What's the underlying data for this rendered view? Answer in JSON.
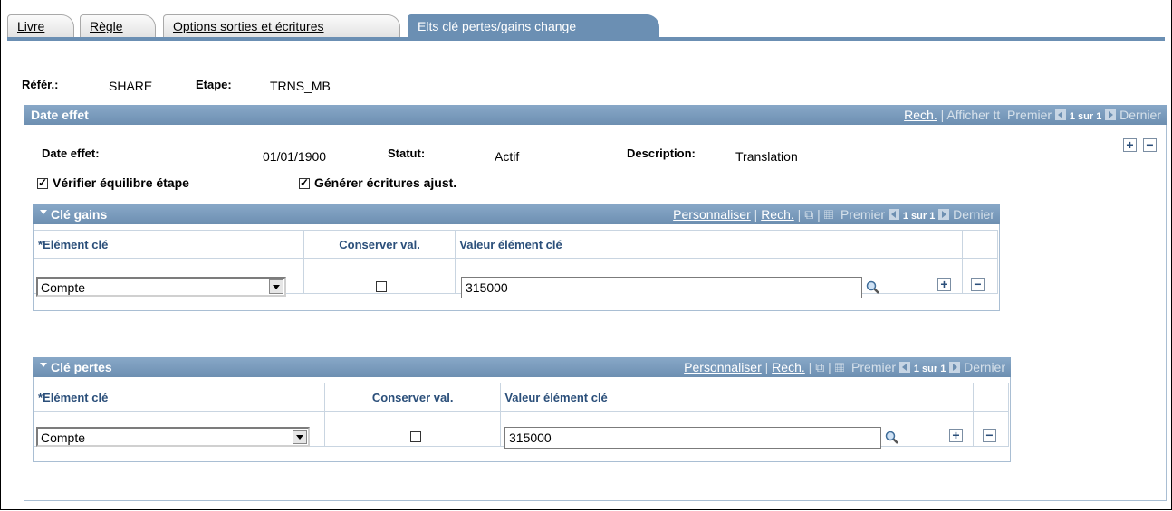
{
  "tabs": [
    "Livre",
    "Règle",
    "Options sorties et écritures",
    "Elts clé pertes/gains change"
  ],
  "header": {
    "refer_label": "Référ.:",
    "refer_value": "SHARE",
    "etape_label": "Etape:",
    "etape_value": "TRNS_MB"
  },
  "date_effet": {
    "title": "Date effet",
    "nav": {
      "search": "Rech.",
      "view_all": "Afficher tt",
      "first": "Premier",
      "count": "1 sur 1",
      "last": "Dernier"
    },
    "date_label": "Date effet:",
    "date_value": "01/01/1900",
    "status_label": "Statut:",
    "status_value": "Actif",
    "desc_label": "Description:",
    "desc_value": "Translation",
    "check1": "Vérifier équilibre étape",
    "check2": "Générer écritures ajust."
  },
  "gains": {
    "title": "Clé gains",
    "nav": {
      "personalize": "Personnaliser",
      "search": "Rech.",
      "first": "Premier",
      "count": "1 sur 1",
      "last": "Dernier"
    },
    "col1": "*Elément clé",
    "col2": "Conserver val.",
    "col3": "Valeur élément clé",
    "element": "Compte",
    "value": "315000"
  },
  "pertes": {
    "title": "Clé pertes",
    "nav": {
      "personalize": "Personnaliser",
      "search": "Rech.",
      "first": "Premier",
      "count": "1 sur 1",
      "last": "Dernier"
    },
    "col1": "*Elément clé",
    "col2": "Conserver val.",
    "col3": "Valeur élément clé",
    "element": "Compte",
    "value": "315000"
  },
  "colors": {
    "header_blue": "#6d8fb1",
    "active_tab": "#6b8fb3",
    "grid_text": "#2b4f7a"
  }
}
